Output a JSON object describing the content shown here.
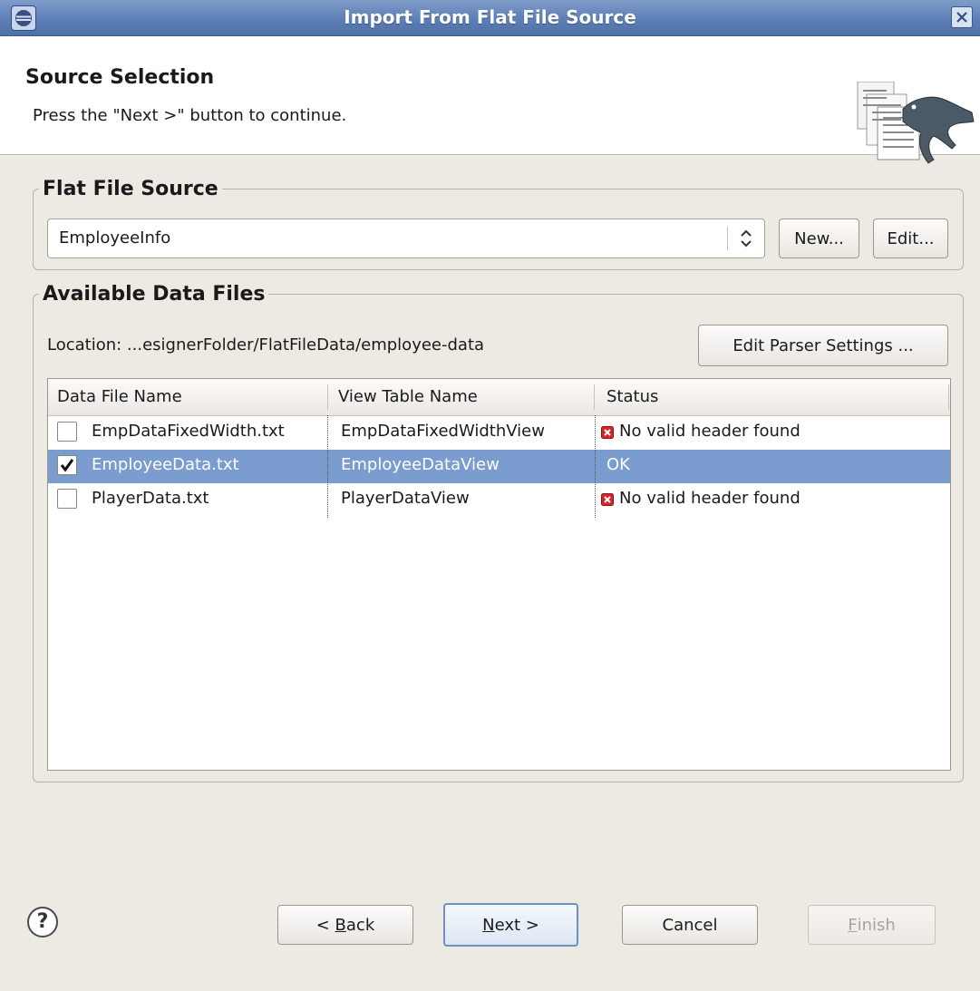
{
  "window": {
    "title": "Import From Flat File Source"
  },
  "header": {
    "title": "Source Selection",
    "description": "Press the \"Next >\" button to continue."
  },
  "flat_file_source": {
    "legend": "Flat File Source",
    "selected_value": "EmployeeInfo",
    "new_label": "New...",
    "edit_label": "Edit..."
  },
  "data_files": {
    "legend": "Available Data Files",
    "location": "Location: ...esignerFolder/FlatFileData/employee-data",
    "edit_parser_label": "Edit Parser Settings ...",
    "columns": [
      "Data File Name",
      "View Table Name",
      "Status"
    ],
    "rows": [
      {
        "file": "EmpDataFixedWidth.txt",
        "view": "EmpDataFixedWidthView",
        "status": "No valid header found",
        "checked": false,
        "error": true
      },
      {
        "file": "EmployeeData.txt",
        "view": "EmployeeDataView",
        "status": "OK",
        "checked": true,
        "error": false
      },
      {
        "file": "PlayerData.txt",
        "view": "PlayerDataView",
        "status": "No valid header found",
        "checked": false,
        "error": true
      }
    ]
  },
  "footer": {
    "back_prefix": "< ",
    "back_mnemonic": "B",
    "back_rest": "ack",
    "next_mnemonic": "N",
    "next_rest": "ext >",
    "cancel_label": "Cancel",
    "finish_mnemonic": "F",
    "finish_rest": "inish"
  },
  "icons": {
    "help": "help-icon",
    "error": "error-icon",
    "close": "close-icon",
    "dropdown": "updown-arrows-icon"
  },
  "colors": {
    "titlebar": "#5d7fb6",
    "selection": "#7a9ccf",
    "error": "#d7262b"
  }
}
